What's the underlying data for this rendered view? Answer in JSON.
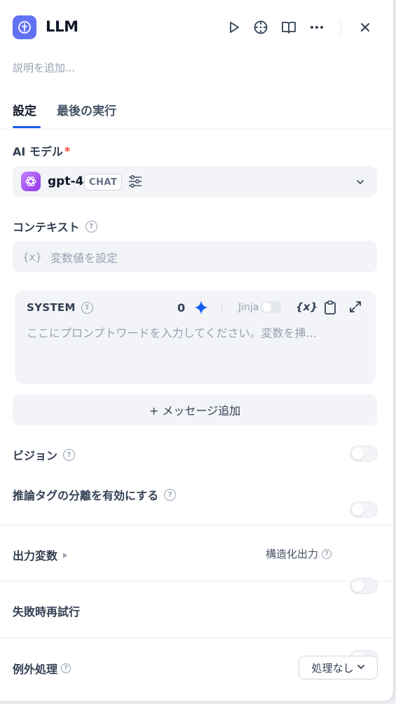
{
  "header": {
    "title": "LLM",
    "icons": [
      "play-icon",
      "crosshair-icon",
      "book-icon",
      "more-icon",
      "close-icon"
    ]
  },
  "description_placeholder": "説明を追加...",
  "tabs": [
    {
      "label": "設定",
      "active": true
    },
    {
      "label": "最後の実行",
      "active": false
    }
  ],
  "model": {
    "label": "AI モデル",
    "required_mark": "*",
    "name": "gpt-4",
    "mode": "CHAT"
  },
  "context": {
    "label": "コンテキスト",
    "placeholder_prefix": "{x}",
    "placeholder": "変数値を設定"
  },
  "system": {
    "label": "SYSTEM",
    "count": "0",
    "jinja": "Jinja",
    "var_label": "{x}",
    "placeholder": "ここにプロンプトワードを入力してください。変数を挿..."
  },
  "add_message": "+ メッセージ追加",
  "vision": {
    "label": "ビジョン",
    "enabled": false
  },
  "reasoning": {
    "label": "推論タグの分離を有効にする",
    "enabled": false
  },
  "output": {
    "label": "出力変数",
    "structured_label": "構造化出力",
    "structured_enabled": false
  },
  "retry": {
    "label": "失敗時再試行",
    "enabled": false
  },
  "exception": {
    "label": "例外処理",
    "value": "処理なし"
  },
  "colors": {
    "accent": "#155eef",
    "node_icon": "#6172f3",
    "model_logo": "#a855f7"
  }
}
